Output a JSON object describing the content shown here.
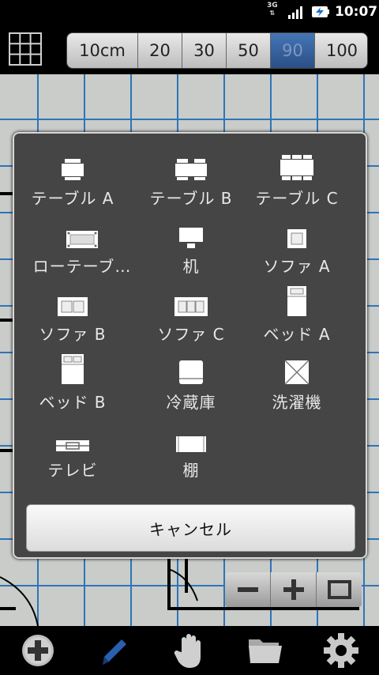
{
  "status_bar": {
    "network": "3G",
    "time": "10:07",
    "icons": [
      "signal-icon",
      "battery-charging-icon"
    ]
  },
  "toolbar": {
    "grid_icon": "grid-icon",
    "scales": [
      "10cm",
      "20",
      "30",
      "50",
      "90",
      "100"
    ],
    "active_scale": "90"
  },
  "dialog": {
    "items": [
      {
        "label": "テーブル A",
        "icon": "table-a-icon"
      },
      {
        "label": "テーブル B",
        "icon": "table-b-icon"
      },
      {
        "label": "テーブル C",
        "icon": "table-c-icon"
      },
      {
        "label": "ローテーブ…",
        "icon": "low-table-icon"
      },
      {
        "label": "机",
        "icon": "desk-icon"
      },
      {
        "label": "ソファ A",
        "icon": "sofa-a-icon"
      },
      {
        "label": "ソファ B",
        "icon": "sofa-b-icon"
      },
      {
        "label": "ソファ C",
        "icon": "sofa-c-icon"
      },
      {
        "label": "ベッド A",
        "icon": "bed-a-icon"
      },
      {
        "label": "ベッド B",
        "icon": "bed-b-icon"
      },
      {
        "label": "冷蔵庫",
        "icon": "refrigerator-icon"
      },
      {
        "label": "洗濯機",
        "icon": "washing-machine-icon"
      },
      {
        "label": "テレビ",
        "icon": "tv-icon"
      },
      {
        "label": "棚",
        "icon": "shelf-icon"
      }
    ],
    "cancel_label": "キャンセル"
  },
  "zoom_controls": [
    "zoom-out-icon",
    "zoom-in-icon",
    "fit-icon"
  ],
  "bottom_bar": [
    "add-icon",
    "pen-icon",
    "hand-icon",
    "folder-icon",
    "settings-icon"
  ],
  "colors": {
    "grid_line": "#2f74b8",
    "canvas_bg": "#c9ccc9",
    "dialog_bg": "#454545",
    "active_scale": "#3463a3",
    "pen_active": "#2a5fb0"
  }
}
